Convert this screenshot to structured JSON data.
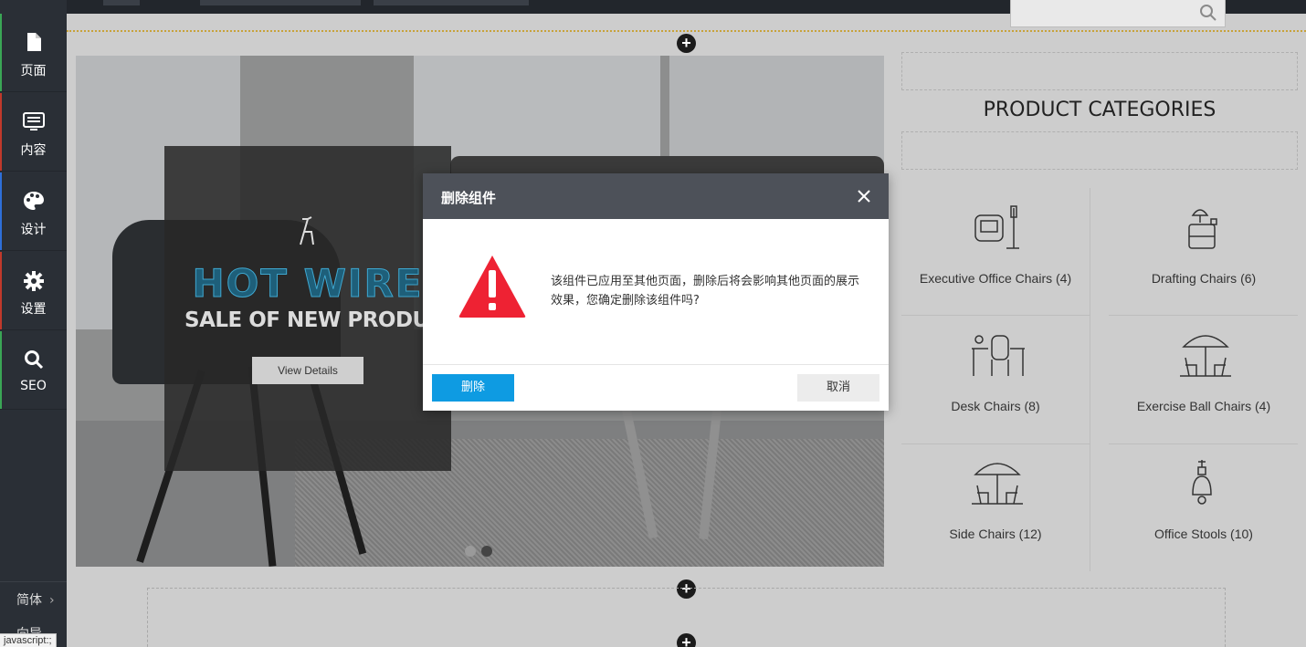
{
  "sidebar": {
    "items": [
      {
        "label": "页面",
        "icon": "page-icon",
        "accent": "#3aa655"
      },
      {
        "label": "内容",
        "icon": "content-icon",
        "accent": "#c0392b"
      },
      {
        "label": "设计",
        "icon": "palette-icon",
        "accent": "#2e6fd8"
      },
      {
        "label": "设置",
        "icon": "gear-icon",
        "accent": "#c0392b"
      },
      {
        "label": "SEO",
        "icon": "search-icon",
        "accent": "#3aa655"
      }
    ],
    "language": "简体",
    "bottom_cut": "向导"
  },
  "status_bar": {
    "url": "javascript:;"
  },
  "hero": {
    "brand": "HOT WIRE",
    "headline": "SALE OF NEW PRODUCTS",
    "button_label": "View Details"
  },
  "product_categories": {
    "title": "PRODUCT CATEGORIES",
    "items": [
      {
        "name": "Executive Office Chairs (4)",
        "icon": "armchair-lamp-icon"
      },
      {
        "name": "Drafting Chairs (6)",
        "icon": "drawer-lamp-icon"
      },
      {
        "name": "Desk Chairs (8)",
        "icon": "desk-chair-icon"
      },
      {
        "name": "Exercise Ball Chairs (4)",
        "icon": "patio-umbrella-icon"
      },
      {
        "name": "Side Chairs (12)",
        "icon": "patio-umbrella-icon"
      },
      {
        "name": "Office Stools (10)",
        "icon": "pendant-lamp-icon"
      }
    ]
  },
  "modal": {
    "title": "删除组件",
    "message": "该组件已应用至其他页面，删除后将会影响其他页面的展示效果，您确定删除该组件吗?",
    "confirm_label": "删除",
    "cancel_label": "取消"
  },
  "colors": {
    "primary": "#0e9be2",
    "warning": "#ee2233",
    "sidebar_bg": "#2a2f36",
    "modal_header": "#4d5159"
  }
}
